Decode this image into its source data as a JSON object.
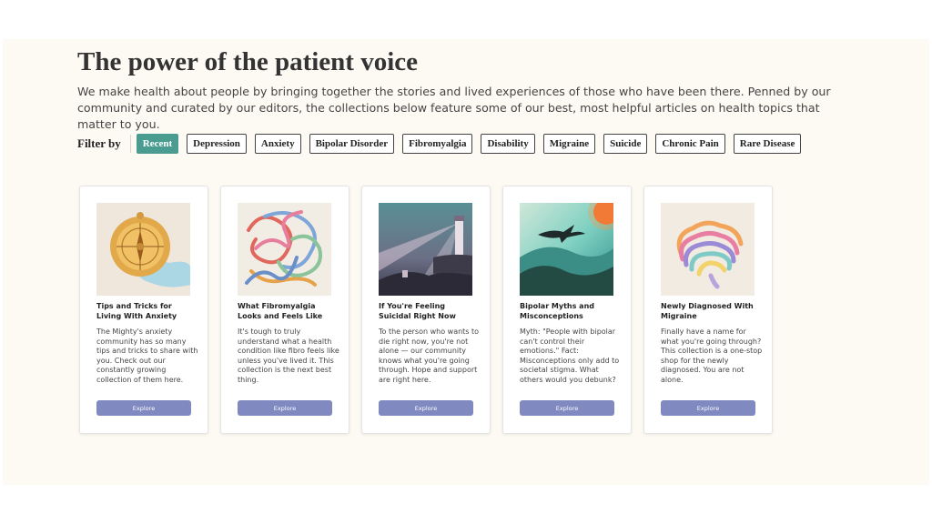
{
  "header": {
    "title": "The power of the patient voice",
    "intro": "We make health about people by bringing together the stories and lived experiences of those who have been there. Penned by our community and curated by our editors, the collections below feature some of our best, most helpful articles on health topics that matter to you."
  },
  "filter": {
    "label": "Filter by",
    "chips": [
      "Recent",
      "Depression",
      "Anxiety",
      "Bipolar Disorder",
      "Fibromyalgia",
      "Disability",
      "Migraine",
      "Suicide",
      "Chronic Pain",
      "Rare Disease"
    ],
    "active": "Recent"
  },
  "cards": [
    {
      "title": "Tips and Tricks for Living With Anxiety",
      "description": "The Mighty's anxiety community has so many tips and tricks to share with you. Check out our constantly growing collection of them here.",
      "button": "Explore",
      "image_icon": "compass-illustration"
    },
    {
      "title": "What Fibromyalgia Looks and Feels Like",
      "description": "It's tough to truly understand what a health condition like fibro feels like unless you've lived it. This collection is the next best thing.",
      "button": "Explore",
      "image_icon": "tangled-lines-illustration"
    },
    {
      "title": "If You're Feeling Suicidal Right Now",
      "description": "To the person who wants to die right now, you're not alone — our community knows what you're going through. Hope and support are right here.",
      "button": "Explore",
      "image_icon": "lighthouse-illustration"
    },
    {
      "title": "Bipolar Myths and Misconceptions",
      "description": "Myth: \"People with bipolar can't control their emotions.\" Fact: Misconceptions only add to societal stigma. What others would you debunk?",
      "button": "Explore",
      "image_icon": "bird-sunset-illustration"
    },
    {
      "title": "Newly Diagnosed With Migraine",
      "description": "Finally have a name for what you're going through? This collection is a one-stop shop for the newly diagnosed. You are not alone.",
      "button": "Explore",
      "image_icon": "brain-illustration"
    }
  ],
  "colors": {
    "section_bg": "#fdf9f3",
    "active_chip": "#4a9c91",
    "explore_button": "#8089c0"
  }
}
